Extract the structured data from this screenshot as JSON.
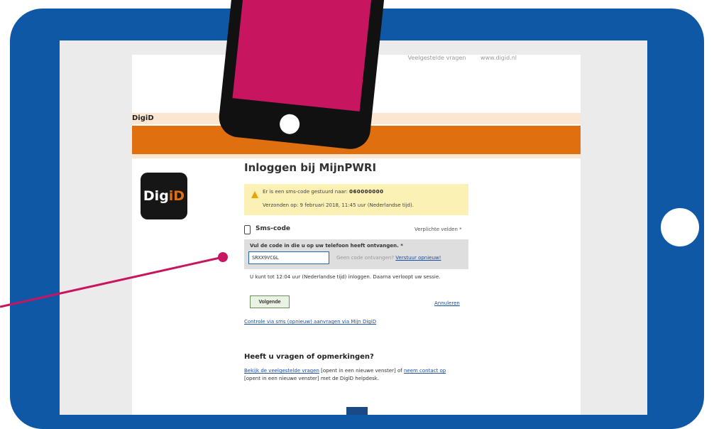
{
  "top_links": {
    "faq": "Veelgestelde vragen",
    "site": "www.digid.nl"
  },
  "header": {
    "title": "DigiD"
  },
  "logo": {
    "text_main": "Dig",
    "text_accent": "iD"
  },
  "login": {
    "title": "Inloggen bij MijnPWRI"
  },
  "notice": {
    "prefix": "Er is een sms-code gestuurd naar:",
    "number": "060000000",
    "sent": "Verzonden op: 9 februari 2018, 11:45 uur (Nederlandse tijd)."
  },
  "sms": {
    "label": "Sms-code",
    "required": "Verplichte velden *"
  },
  "code": {
    "instruction": "Vul de code in die u op uw telefoon heeft ontvangen. *",
    "value": "SRXX9VCGL",
    "resend_prompt": "Geen code ontvangen?",
    "resend_link": "Verstuur opnieuw!"
  },
  "session": {
    "text": "U kunt tot 12:04 uur (Nederlandse tijd) inloggen. Daarna verloopt uw sessie."
  },
  "actions": {
    "next": "Volgende",
    "cancel": "Annuleren",
    "resend_sms": "Controle via sms (opnieuw) aanvragen via Mijn DigiD"
  },
  "questions": {
    "title": "Heeft u vragen of opmerkingen?",
    "link1": "Bekijk de veelgestelde vragen",
    "text1": "[opent in een nieuwe venster] of",
    "link2": "neem contact op",
    "text2": "[opent in een nieuwe venster] met de DigiD helpdesk."
  },
  "colors": {
    "tablet_frame": "#0f58a6",
    "digid_orange": "#e0700f",
    "phone_screen": "#c81560",
    "pointer": "#c81560"
  }
}
